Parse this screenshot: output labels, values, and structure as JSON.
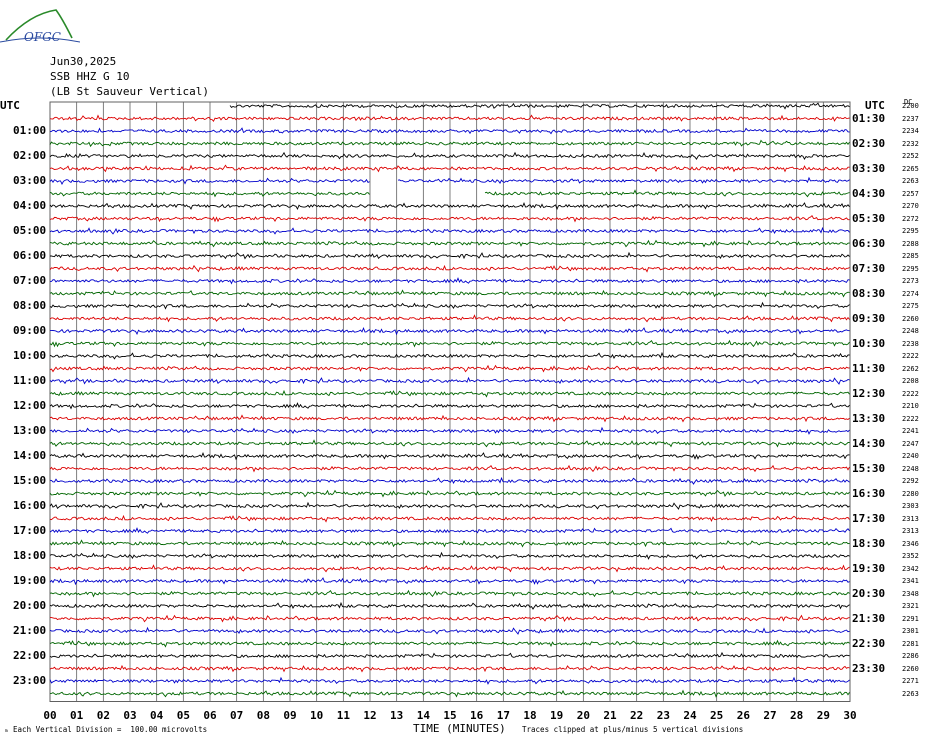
{
  "header": {
    "logo_text": "OFGC",
    "date": "Jun30,2025",
    "station": "SSB HHZ G 10",
    "location": "(LB St Sauveur Vertical)"
  },
  "utc_left": "UTC",
  "utc_right": "UTC",
  "dc_header": "DC",
  "colors": {
    "black": "#000000",
    "red": "#dd0000",
    "blue": "#0000cc",
    "green": "#006600",
    "grid": "#606060"
  },
  "chart_data": {
    "type": "line",
    "title": "SSB HHZ G 10",
    "xlabel": "TIME (MINUTES)",
    "x_ticks": [
      "00",
      "01",
      "02",
      "03",
      "04",
      "05",
      "06",
      "07",
      "08",
      "09",
      "10",
      "11",
      "12",
      "13",
      "14",
      "15",
      "16",
      "17",
      "18",
      "19",
      "20",
      "21",
      "22",
      "23",
      "24",
      "25",
      "26",
      "27",
      "28",
      "29",
      "30"
    ],
    "left_hour_labels": [
      "01:00",
      "02:00",
      "03:00",
      "04:00",
      "05:00",
      "06:00",
      "07:00",
      "08:00",
      "09:00",
      "10:00",
      "11:00",
      "12:00",
      "13:00",
      "14:00",
      "15:00",
      "16:00",
      "17:00",
      "18:00",
      "19:00",
      "20:00",
      "21:00",
      "22:00",
      "23:00"
    ],
    "right_half_labels": [
      "01:30",
      "02:30",
      "03:30",
      "04:30",
      "05:30",
      "06:30",
      "07:30",
      "08:30",
      "09:30",
      "10:30",
      "11:30",
      "12:30",
      "13:30",
      "14:30",
      "15:30",
      "16:30",
      "17:30",
      "18:30",
      "19:30",
      "20:30",
      "21:30",
      "22:30",
      "23:30"
    ],
    "trace_color_cycle": [
      "black",
      "red",
      "blue",
      "green"
    ],
    "dc_offsets": [
      "2200",
      "2237",
      "2234",
      "2232",
      "2252",
      "2265",
      "2263",
      "2257",
      "2270",
      "2272",
      "2295",
      "2288",
      "2285",
      "2295",
      "2273",
      "2274",
      "2275",
      "2260",
      "2248",
      "2238",
      "2222",
      "2262",
      "2208",
      "2222",
      "2210",
      "2222",
      "2241",
      "2247",
      "2240",
      "2248",
      "2292",
      "2280",
      "2303",
      "2313",
      "2313",
      "2346",
      "2352",
      "2342",
      "2341",
      "2348",
      "2321",
      "2291",
      "2301",
      "2281",
      "2286",
      "2260",
      "2271",
      "2263"
    ],
    "gaps": [
      {
        "trace_index": 0,
        "from_minute": 0,
        "to_minute": 6.7,
        "note": "trace starts at 00:06.7"
      },
      {
        "trace_index": 6,
        "from_minute": 12,
        "to_minute": 13.0
      },
      {
        "trace_index": 7,
        "from_minute": 12,
        "to_minute": 16.3
      }
    ]
  },
  "footer": {
    "left": "Each Vertical Division =  100.00 microvolts",
    "right": "Traces clipped at plus/minus 5 vertical divisions"
  }
}
